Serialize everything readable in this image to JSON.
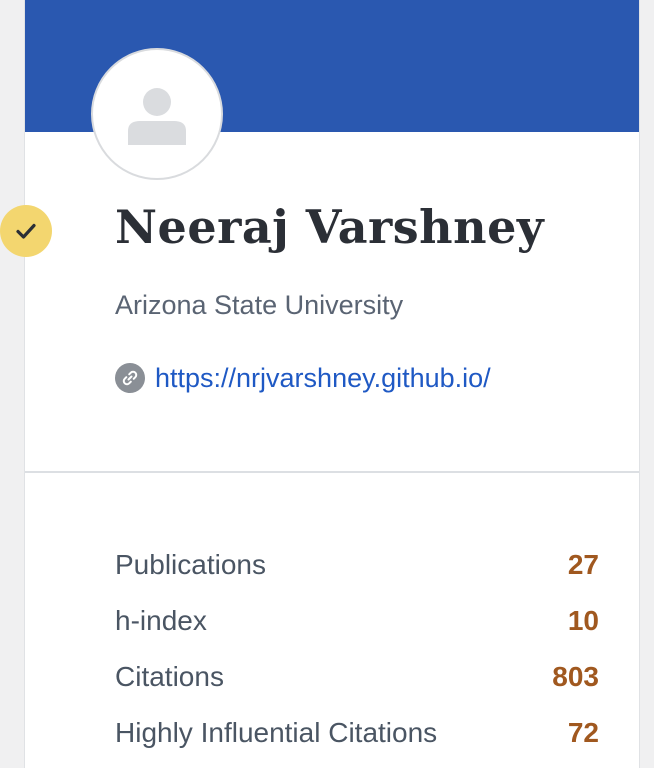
{
  "profile": {
    "name": "Neeraj Varshney",
    "affiliation": "Arizona State University",
    "homepage": "https://nrjvarshney.github.io/",
    "verified": true
  },
  "icons": {
    "avatar": "user-placeholder-icon",
    "verified": "check-icon",
    "link": "link-icon"
  },
  "colors": {
    "banner": "#2a58b0",
    "verified_badge": "#f3d66f",
    "link": "#1f59c4",
    "stat_value": "#a0581f"
  },
  "stats": [
    {
      "label": "Publications",
      "value": "27"
    },
    {
      "label": "h-index",
      "value": "10"
    },
    {
      "label": "Citations",
      "value": "803"
    },
    {
      "label": "Highly Influential Citations",
      "value": "72"
    }
  ]
}
